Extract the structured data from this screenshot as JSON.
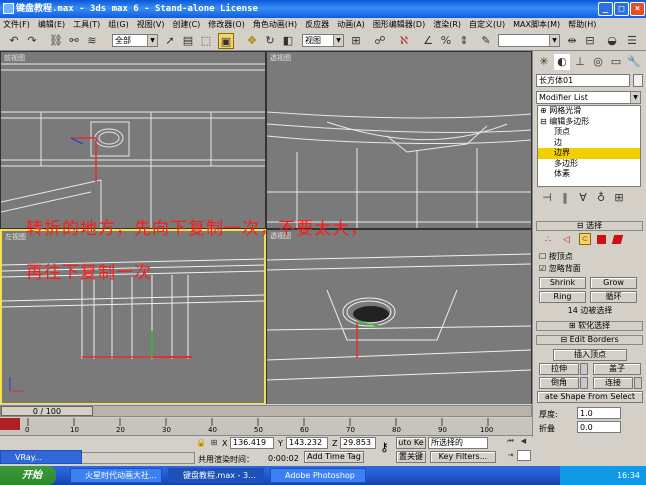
{
  "window": {
    "title": "键盘教程.max - 3ds max 6 - Stand-alone License"
  },
  "menu": [
    "文件(F)",
    "编辑(E)",
    "工具(T)",
    "组(G)",
    "视图(V)",
    "创建(C)",
    "修改器(O)",
    "角色动画(H)",
    "反应器",
    "动画(A)",
    "图形编辑器(D)",
    "渲染(R)",
    "自定义(U)",
    "MAX脚本(M)",
    "帮助(H)"
  ],
  "toolbar": {
    "selection_filter": "全部",
    "coord_system": "视图"
  },
  "viewports": {
    "top_left": "前视图",
    "top_right": "透视图",
    "bottom_left": "左视图",
    "bottom_right": "透视图"
  },
  "annotation": {
    "line1": "转折的地方，先向下复制一次，不要太大，",
    "line2": "再往下复制一次"
  },
  "panel": {
    "object_name": "长方体01",
    "modifier_list": "Modifier List",
    "stack": [
      "网格光滑",
      "编辑多边形",
      "顶点",
      "边",
      "边界",
      "多边形",
      "体素"
    ],
    "selection": {
      "header": "选择",
      "by_vertex": "按顶点",
      "ignore_backfacing": "忽略背面",
      "shrink": "Shrink",
      "grow": "Grow",
      "ring": "Ring",
      "loop": "循环",
      "status": "14 边被选择"
    },
    "soft_selection": "软化选择",
    "edit_borders": {
      "header": "Edit Borders",
      "insert_vertex": "插入顶点",
      "extrude": "拉伸",
      "cap": "盖子",
      "chamfer": "倒角",
      "bridge": "连接",
      "create_shape": "ate Shape From Select",
      "thickness_label": "厚度:",
      "thickness": "1.0",
      "fold_label": "折叠",
      "fold": "0.0"
    }
  },
  "timeline": {
    "frame": "0 / 100",
    "ticks": [
      "0",
      "10",
      "20",
      "30",
      "40",
      "50",
      "60",
      "70",
      "80",
      "90",
      "100"
    ]
  },
  "status": {
    "x": "136.419",
    "y": "143.232",
    "z": "29.853",
    "message": "共用渲染时间：",
    "time": "0:00:02",
    "add_time_tag": "Add Time Tag",
    "auto_key": "uto Ke",
    "set_key": "置关键",
    "key_filter_mode": "所选择的",
    "key_filters": "Key Filters..."
  },
  "taskbar": {
    "start": "开始",
    "tasks": [
      "火星时代动画大社...",
      "键盘教程.max - 3...",
      "Adobe Photoshop"
    ],
    "small_task": "VRay...",
    "clock": "16:34"
  }
}
